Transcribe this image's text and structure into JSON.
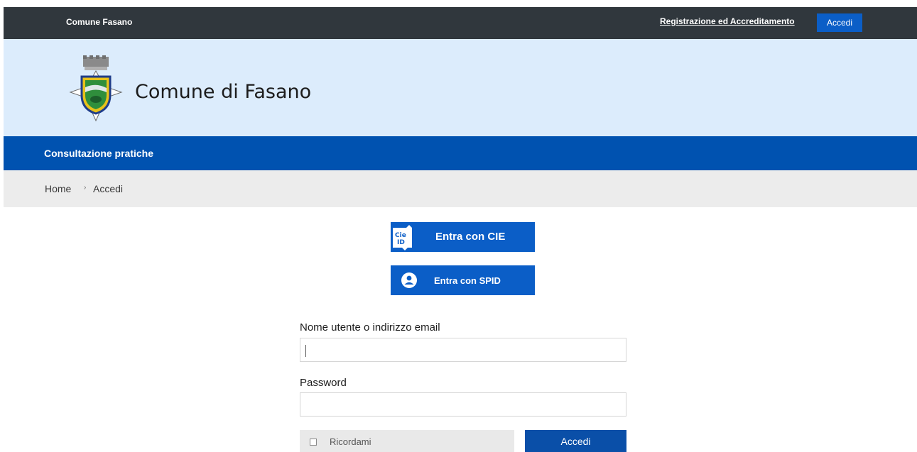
{
  "topbar": {
    "brand": "Comune Fasano",
    "register_link": "Registrazione ed Accreditamento",
    "login_button": "Accedi"
  },
  "header": {
    "title": "Comune di Fasano",
    "crest_icon": "municipal-crest-icon"
  },
  "navbar": {
    "item": "Consultazione pratiche"
  },
  "breadcrumb": {
    "home": "Home",
    "separator": "›",
    "current": "Accedi"
  },
  "identity_providers": {
    "cie_label": "Entra con CIE",
    "cie_icon": "cie-id-icon",
    "spid_label": "Entra con SPID",
    "spid_icon": "spid-user-icon"
  },
  "login_form": {
    "username_label": "Nome utente o indirizzo email",
    "username_value": "",
    "password_label": "Password",
    "password_value": "",
    "remember_label": "Ricordami",
    "remember_checked": false,
    "submit_label": "Accedi"
  },
  "colors": {
    "topbar_bg": "#30373d",
    "header_bg": "#dcecfc",
    "navbar_bg": "#0052b0",
    "breadcrumb_bg": "#ececec",
    "primary_button": "#0b5ec7"
  }
}
